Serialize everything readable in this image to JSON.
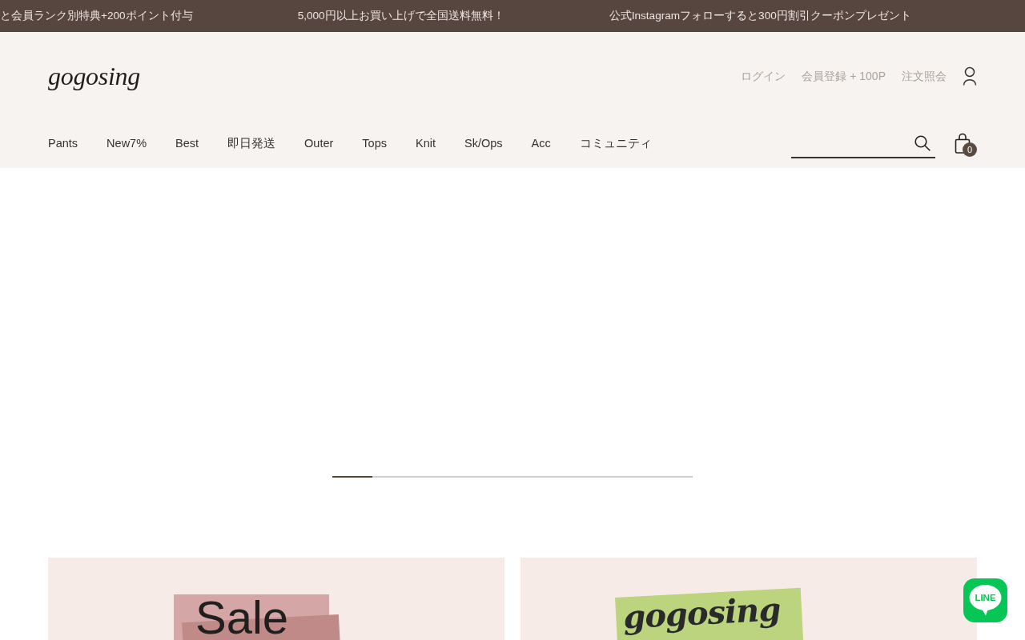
{
  "announcement_bar": {
    "messages": [
      "と会員ランク別特典+200ポイント付与",
      "5,000円以上お買い上げで全国送料無料！",
      "公式Instagramフォローすると300円割引クーポンプレゼント"
    ]
  },
  "header": {
    "logo": "gogosing",
    "account_links": [
      "ログイン",
      "会員登録 + 100P",
      "注文照会"
    ],
    "nav": [
      "Pants",
      "New7%",
      "Best",
      "即日発送",
      "Outer",
      "Tops",
      "Knit",
      "Sk/Ops",
      "Acc",
      "コミュニティ"
    ],
    "cart": {
      "count": "0"
    }
  },
  "hero_slider": {
    "progress": {
      "level": 0.11
    }
  },
  "banners": [
    {
      "kind": "sale",
      "title": "Sale"
    },
    {
      "kind": "brand",
      "title": "gogosing"
    }
  ],
  "line_button": {
    "label": "LINE"
  }
}
